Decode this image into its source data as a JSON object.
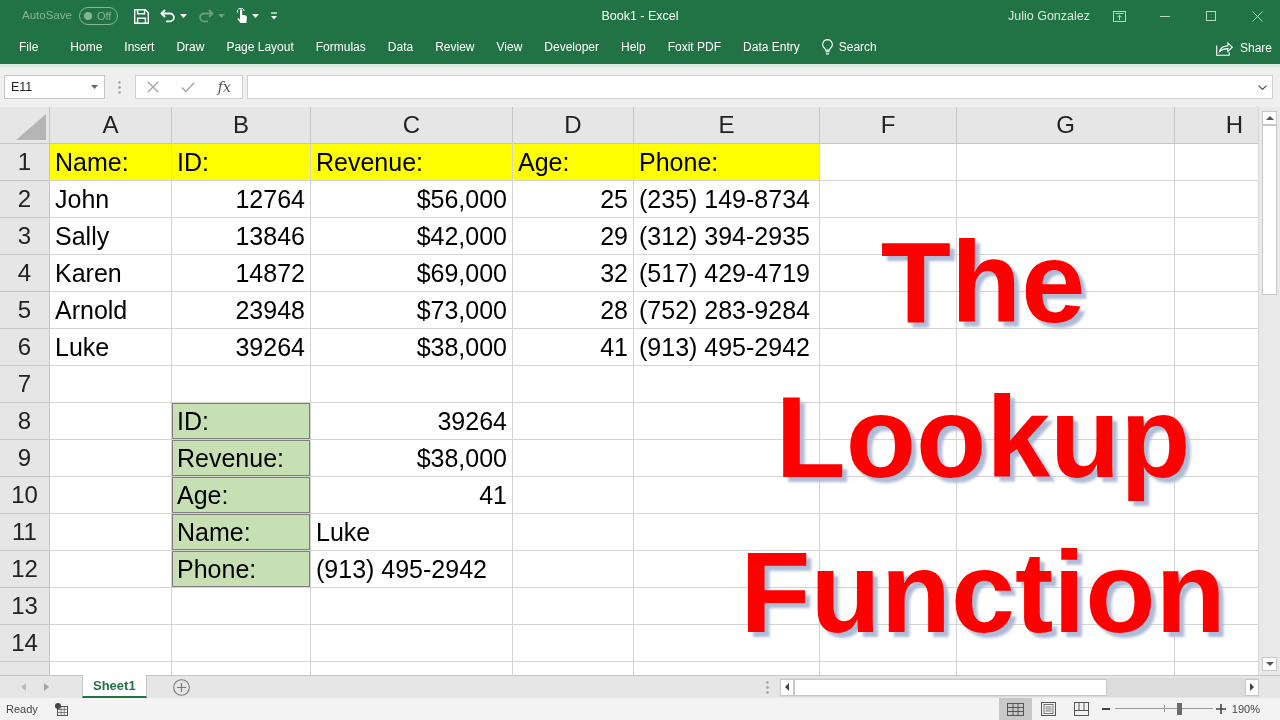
{
  "title_bar": {
    "autosave": {
      "label": "AutoSave",
      "toggle_label": "Off",
      "on": false,
      "disabled": true
    },
    "quick_access": [
      {
        "kind": "save",
        "disabled": false,
        "has_menu": false
      },
      {
        "kind": "undo",
        "disabled": false,
        "has_menu": true
      },
      {
        "kind": "redo",
        "disabled": true,
        "has_menu": true
      },
      {
        "kind": "touch",
        "disabled": false,
        "has_menu": true
      },
      {
        "kind": "customize",
        "disabled": false,
        "has_menu": false
      }
    ],
    "title": "Book1 - Excel",
    "user": "Julio Gonzalez"
  },
  "ribbon": {
    "tabs": [
      {
        "label": "File",
        "selected": false
      },
      {
        "label": "Home",
        "selected": false
      },
      {
        "label": "Insert",
        "selected": false
      },
      {
        "label": "Draw",
        "selected": false
      },
      {
        "label": "Page Layout",
        "selected": false
      },
      {
        "label": "Formulas",
        "selected": false
      },
      {
        "label": "Data",
        "selected": false
      },
      {
        "label": "Review",
        "selected": false
      },
      {
        "label": "View",
        "selected": false
      },
      {
        "label": "Developer",
        "selected": false
      },
      {
        "label": "Help",
        "selected": false
      },
      {
        "label": "Foxit PDF",
        "selected": false
      },
      {
        "label": "Data Entry",
        "selected": false
      }
    ],
    "search": "Search",
    "share": "Share"
  },
  "formula_bar": {
    "name_box": "E11",
    "insert_function": "fx"
  },
  "sheet": {
    "columns": [
      "A",
      "B",
      "C",
      "D",
      "E",
      "F",
      "G",
      "H"
    ],
    "rows": [
      {
        "header": "1",
        "cells": [
          {
            "text": "Name:",
            "kind": "text",
            "color": "#ffff00",
            "bordered": false
          },
          {
            "text": "ID:",
            "kind": "text",
            "color": "#ffff00",
            "bordered": false
          },
          {
            "text": "Revenue:",
            "kind": "text",
            "color": "#ffff00",
            "bordered": false
          },
          {
            "text": "Age:",
            "kind": "text",
            "color": "#ffff00",
            "bordered": false
          },
          {
            "text": "Phone:",
            "kind": "text",
            "color": "#ffff00",
            "bordered": false
          }
        ]
      },
      {
        "header": "2",
        "cells": [
          {
            "text": "John",
            "kind": "text",
            "bordered": false
          },
          {
            "text": "12764",
            "kind": "number",
            "bordered": false
          },
          {
            "text": "$56,000",
            "kind": "number",
            "bordered": false
          },
          {
            "text": "25",
            "kind": "number",
            "bordered": false
          },
          {
            "text": "(235) 149-8734",
            "kind": "text",
            "bordered": false
          }
        ]
      },
      {
        "header": "3",
        "cells": [
          {
            "text": "Sally",
            "kind": "text",
            "bordered": false
          },
          {
            "text": "13846",
            "kind": "number",
            "bordered": false
          },
          {
            "text": "$42,000",
            "kind": "number",
            "bordered": false
          },
          {
            "text": "29",
            "kind": "number",
            "bordered": false
          },
          {
            "text": "(312) 394-2935",
            "kind": "text",
            "bordered": false
          }
        ]
      },
      {
        "header": "4",
        "cells": [
          {
            "text": "Karen",
            "kind": "text",
            "bordered": false
          },
          {
            "text": "14872",
            "kind": "number",
            "bordered": false
          },
          {
            "text": "$69,000",
            "kind": "number",
            "bordered": false
          },
          {
            "text": "32",
            "kind": "number",
            "bordered": false
          },
          {
            "text": "(517) 429-4719",
            "kind": "text",
            "bordered": false
          }
        ]
      },
      {
        "header": "5",
        "cells": [
          {
            "text": "Arnold",
            "kind": "text",
            "bordered": false
          },
          {
            "text": "23948",
            "kind": "number",
            "bordered": false
          },
          {
            "text": "$73,000",
            "kind": "number",
            "bordered": false
          },
          {
            "text": "28",
            "kind": "number",
            "bordered": false
          },
          {
            "text": "(752) 283-9284",
            "kind": "text",
            "bordered": false
          }
        ]
      },
      {
        "header": "6",
        "cells": [
          {
            "text": "Luke",
            "kind": "text",
            "bordered": false
          },
          {
            "text": "39264",
            "kind": "number",
            "bordered": false
          },
          {
            "text": "$38,000",
            "kind": "number",
            "bordered": false
          },
          {
            "text": "41",
            "kind": "number",
            "bordered": false
          },
          {
            "text": "(913) 495-2942",
            "kind": "text",
            "bordered": false
          }
        ]
      },
      {
        "header": "7"
      },
      {
        "header": "8",
        "cells": [
          {},
          {
            "text": "ID:",
            "kind": "text",
            "color": "#c6e0b4",
            "bordered": true
          },
          {
            "text": "39264",
            "kind": "number",
            "bordered": false
          }
        ]
      },
      {
        "header": "9",
        "cells": [
          {},
          {
            "text": "Revenue:",
            "kind": "text",
            "color": "#c6e0b4",
            "bordered": true
          },
          {
            "text": "$38,000",
            "kind": "number",
            "bordered": false
          }
        ]
      },
      {
        "header": "10",
        "cells": [
          {},
          {
            "text": "Age:",
            "kind": "text",
            "color": "#c6e0b4",
            "bordered": true
          },
          {
            "text": "41",
            "kind": "number",
            "bordered": false
          }
        ]
      },
      {
        "header": "11",
        "cells": [
          {},
          {
            "text": "Name:",
            "kind": "text",
            "color": "#c6e0b4",
            "bordered": true
          },
          {
            "text": "Luke",
            "kind": "text",
            "bordered": false
          }
        ]
      },
      {
        "header": "12",
        "cells": [
          {},
          {
            "text": "Phone:",
            "kind": "text",
            "color": "#c6e0b4",
            "bordered": true
          },
          {
            "text": "(913) 495-2942",
            "kind": "text",
            "bordered": false
          }
        ]
      },
      {
        "header": "13"
      },
      {
        "header": "14"
      }
    ]
  },
  "overlay_title": {
    "lines": [
      "The",
      "Lookup",
      "Function"
    ]
  },
  "sheet_tabs": [
    {
      "label": "Sheet1",
      "selected": true
    }
  ],
  "status_bar": {
    "mode": "Ready",
    "views": [
      {
        "kind": "normal",
        "selected": true
      },
      {
        "kind": "page_layout",
        "selected": false
      },
      {
        "kind": "page_break_preview",
        "selected": false
      }
    ],
    "zoom": {
      "level": 0.65,
      "label": "190%"
    }
  }
}
